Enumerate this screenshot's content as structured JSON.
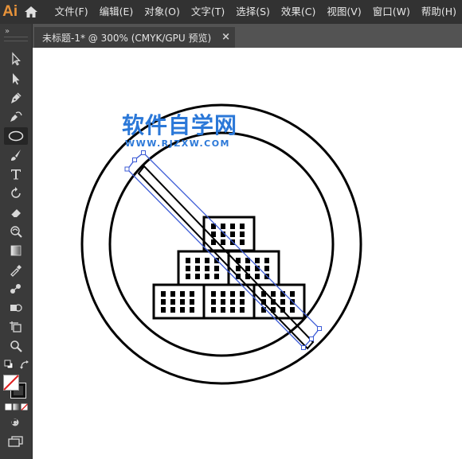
{
  "app": {
    "logo": "Ai"
  },
  "menu": [
    {
      "label": "文件(F)"
    },
    {
      "label": "编辑(E)"
    },
    {
      "label": "对象(O)"
    },
    {
      "label": "文字(T)"
    },
    {
      "label": "选择(S)"
    },
    {
      "label": "效果(C)"
    },
    {
      "label": "视图(V)"
    },
    {
      "label": "窗口(W)"
    },
    {
      "label": "帮助(H)"
    }
  ],
  "toolbar": {
    "collapse_glyph": "»",
    "tools": [
      {
        "icon": "selection-arrow-icon"
      },
      {
        "icon": "direct-selection-icon"
      },
      {
        "icon": "pen-icon"
      },
      {
        "icon": "curvature-icon"
      },
      {
        "icon": "ellipse-icon",
        "active": true
      },
      {
        "icon": "paintbrush-icon"
      },
      {
        "icon": "type-icon",
        "glyph": "T"
      },
      {
        "icon": "rotate-icon"
      },
      {
        "icon": "eraser-icon"
      },
      {
        "icon": "warp-icon"
      },
      {
        "icon": "gradient-icon"
      },
      {
        "icon": "eyedropper-icon"
      },
      {
        "icon": "blend-icon"
      },
      {
        "icon": "shape-builder-icon"
      },
      {
        "icon": "artboard-icon"
      },
      {
        "icon": "zoom-icon"
      }
    ]
  },
  "document_tab": {
    "title": "未标题-1* @ 300% (CMYK/GPU 预览)",
    "close_glyph": "×"
  },
  "watermark": {
    "title": "软件自学网",
    "url": "WWW.RJZXW.COM"
  },
  "colors": {
    "menubar": "#323232",
    "toolbar": "#3a3a3a",
    "workspace": "#535353",
    "canvas": "#ffffff",
    "selection": "#3c5bd6",
    "watermark": "#2b78d8",
    "app_logo": "#e8933a"
  }
}
